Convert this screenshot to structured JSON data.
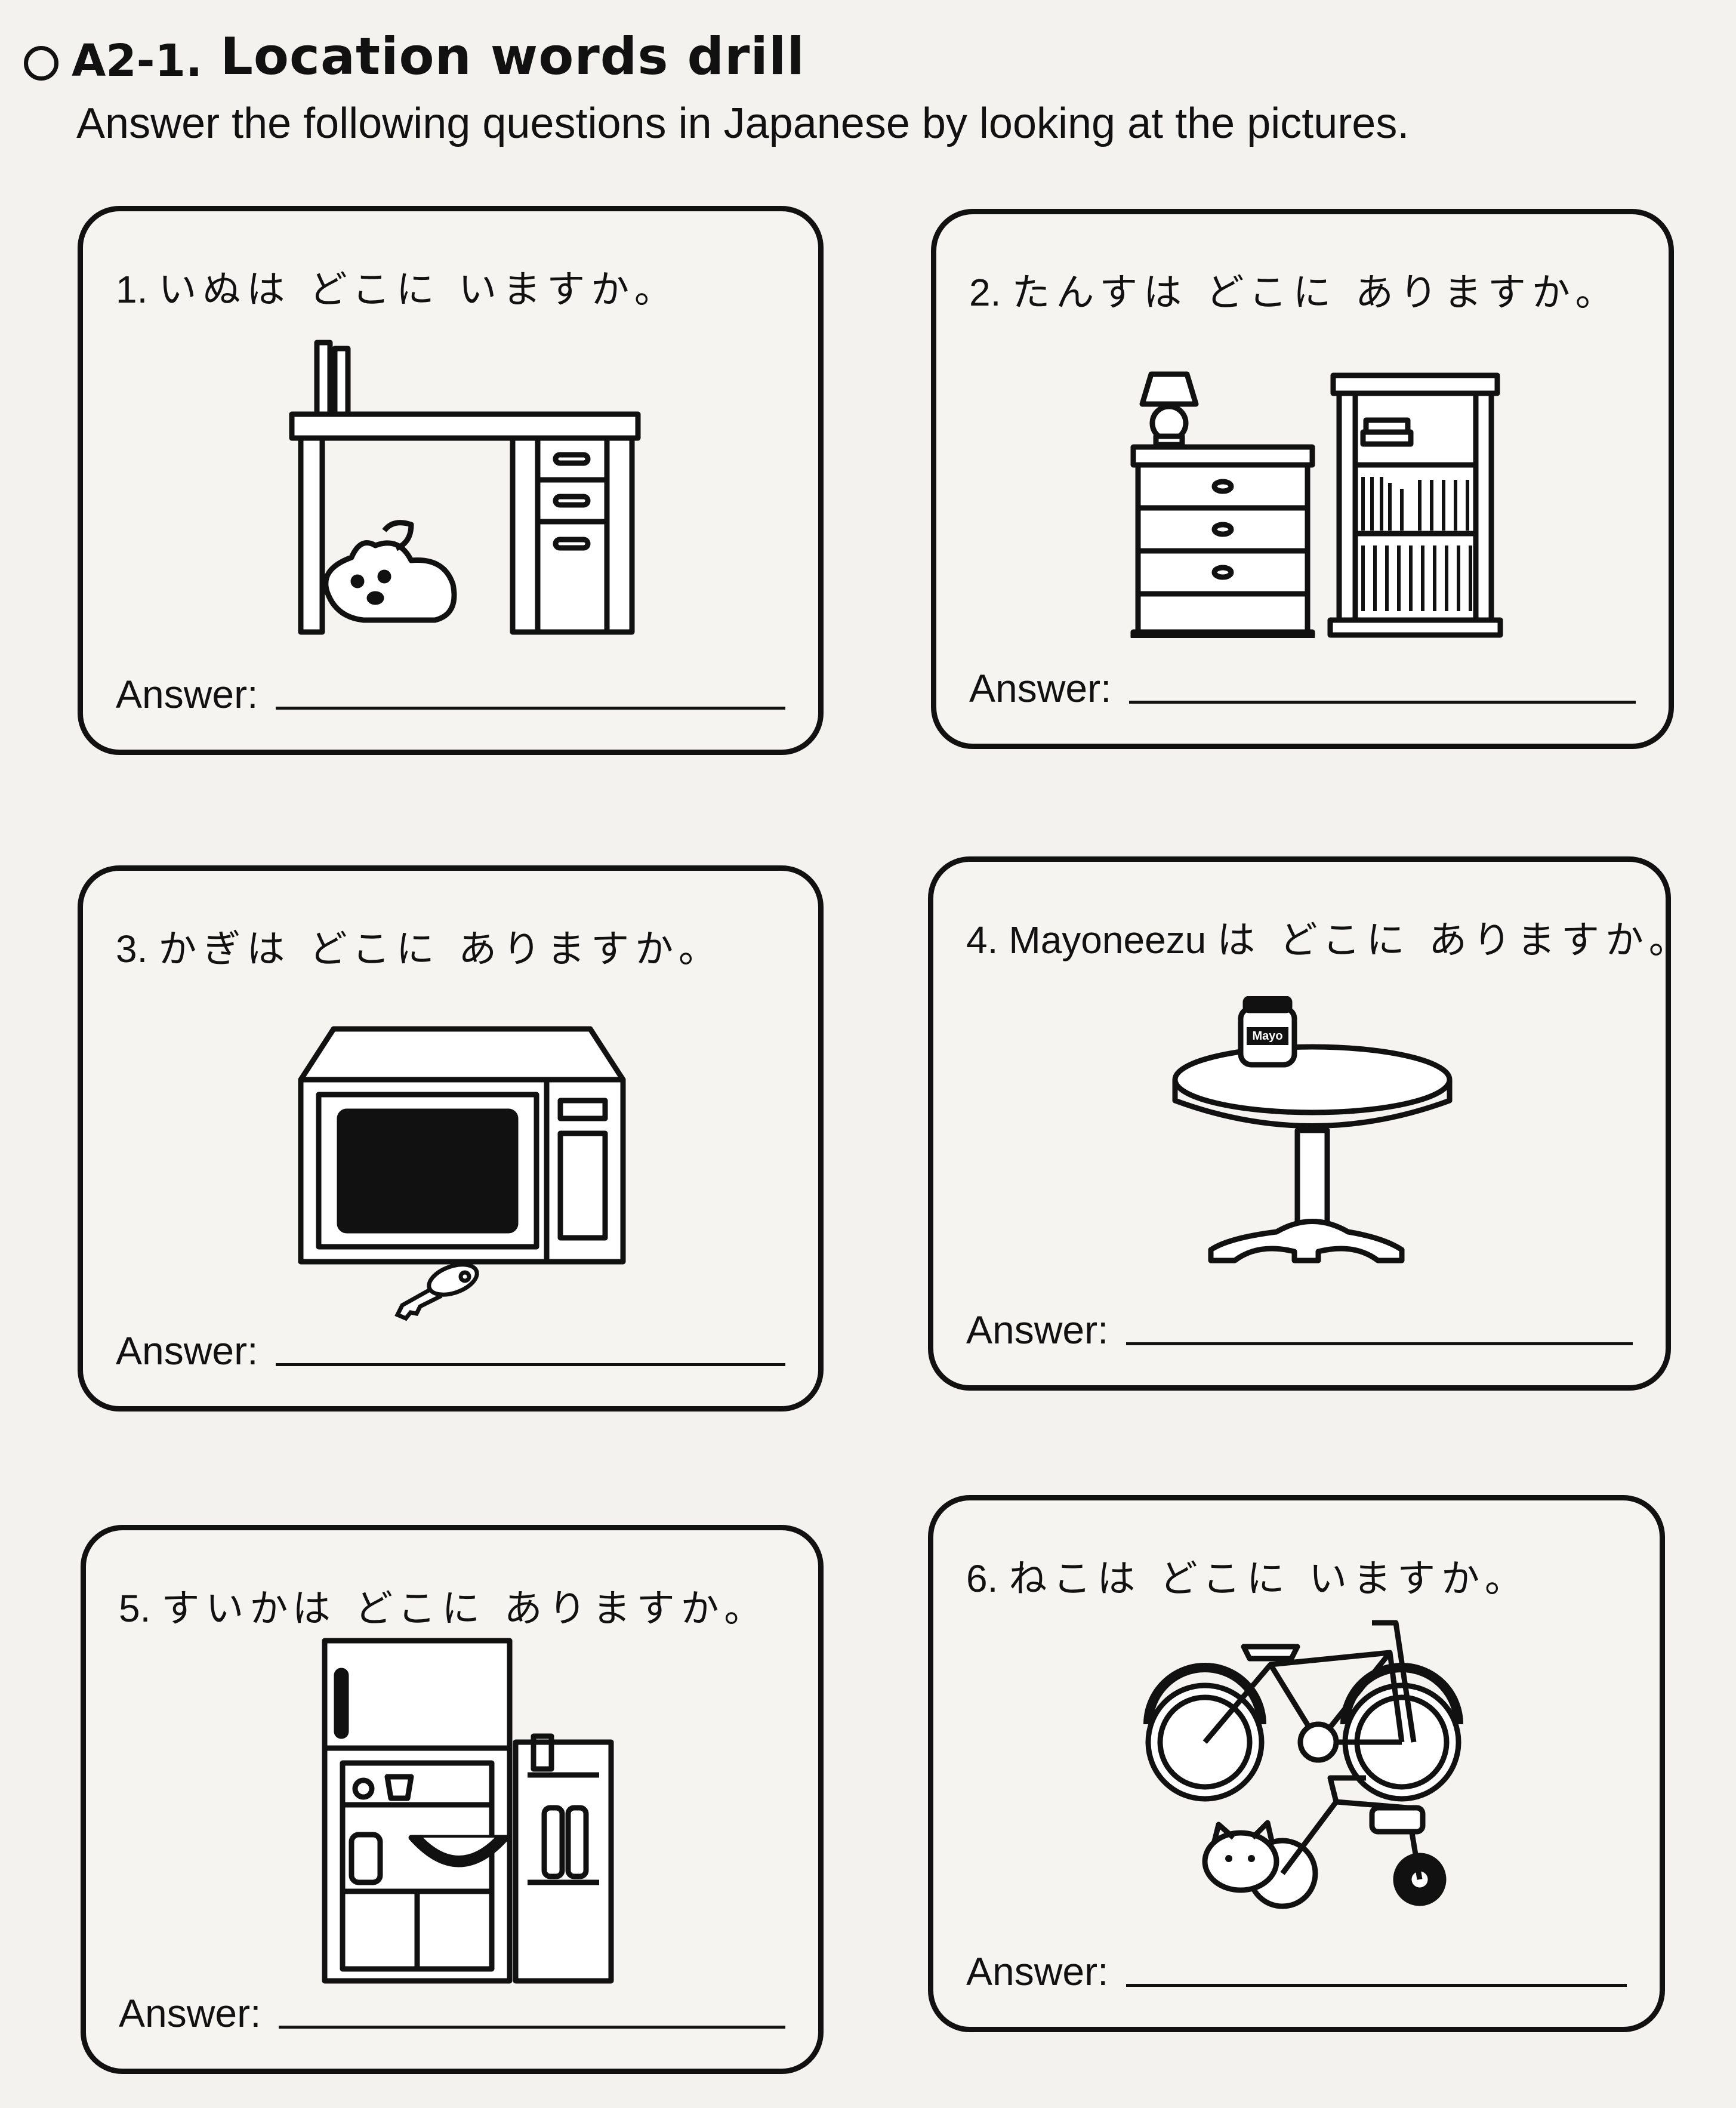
{
  "header": {
    "exercise_number": "A2-1.",
    "title": "Location words drill",
    "instruction": "Answer the following questions in Japanese by looking at the pictures."
  },
  "answer_label": "Answer:",
  "questions": [
    {
      "number": "1.",
      "text": "いぬは どこに いますか。",
      "picture": "dog-under-desk"
    },
    {
      "number": "2.",
      "text": "たんすは どこに ありますか。",
      "picture": "dresser-next-to-bookshelf"
    },
    {
      "number": "3.",
      "text": "かぎは どこに ありますか。",
      "picture": "key-under-microwave"
    },
    {
      "number": "4.",
      "prefix": "Mayoneezu",
      "text": "は どこに ありますか。",
      "picture": "mayonnaise-on-table",
      "jar_label": "Mayo"
    },
    {
      "number": "5.",
      "text": "すいかは どこに ありますか。",
      "picture": "watermelon-in-refrigerator"
    },
    {
      "number": "6.",
      "text": "ねこは どこに いますか。",
      "picture": "cat-between-bicycles"
    }
  ]
}
